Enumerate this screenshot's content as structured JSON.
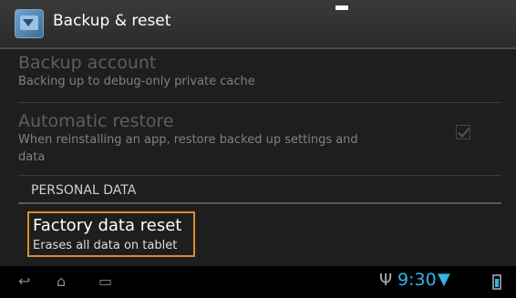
{
  "header": {
    "title": "Backup & reset",
    "icon": "backup-icon"
  },
  "settings": {
    "backup_account": {
      "title": "Backup account",
      "summary": "Backing up to debug-only private cache"
    },
    "automatic_restore": {
      "title": "Automatic restore",
      "summary_line1": "When reinstalling an app, restore backed up settings and",
      "summary_line2": "data",
      "checked": true
    },
    "section_personal": "PERSONAL DATA",
    "factory_reset": {
      "title": "Factory data reset",
      "summary": "Erases all data on tablet"
    }
  },
  "status_bar": {
    "time": "9:30",
    "icons": [
      "usb-icon",
      "wifi-icon",
      "battery-icon"
    ],
    "nav": [
      "back-icon",
      "home-icon",
      "recent-apps-icon"
    ]
  },
  "colors": {
    "accent": "#2fb5e6",
    "highlight_border": "#e08a2e",
    "background": "#1e1e1e"
  }
}
